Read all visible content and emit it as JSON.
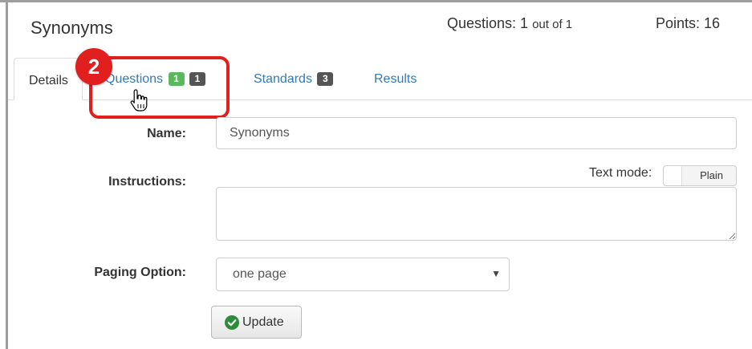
{
  "header": {
    "title": "Synonyms",
    "questions_prefix": "Questions: 1",
    "questions_suffix": "out of 1",
    "points": "Points: 16"
  },
  "tabs": [
    {
      "label": "Details",
      "active": true
    },
    {
      "label": "Questions",
      "badges": [
        "1",
        "1"
      ]
    },
    {
      "label": "Standards",
      "badges": [
        "3"
      ]
    },
    {
      "label": "Results"
    }
  ],
  "annotation": {
    "step_number": "2",
    "color": "#e11f1f",
    "cursor_icon": "hand-pointer-icon"
  },
  "form": {
    "name_label": "Name:",
    "name_value": "Synonyms",
    "instructions_label": "Instructions:",
    "instructions_value": "",
    "text_mode_label": "Text mode:",
    "text_mode_value": "Plain",
    "paging_label": "Paging Option:",
    "paging_value": "one page",
    "update_label": "Update",
    "update_icon": "check-circle-icon"
  },
  "colors": {
    "link": "#337ab7",
    "badge_green": "#5cb85c",
    "badge_gray": "#555555",
    "update_icon_green": "#2e8b3a"
  }
}
